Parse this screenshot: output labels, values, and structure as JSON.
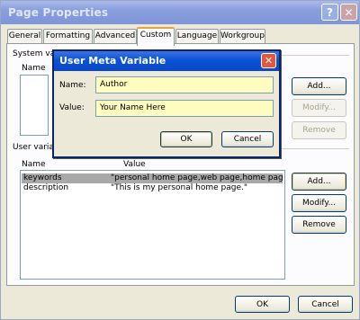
{
  "window": {
    "title": "Page Properties",
    "help_glyph": "?",
    "close_glyph": "✕"
  },
  "tabs": [
    "General",
    "Formatting",
    "Advanced",
    "Custom",
    "Language",
    "Workgroup"
  ],
  "active_tab": "Custom",
  "system_vars": {
    "group_label": "System var",
    "col_name": "Name",
    "buttons": {
      "add": "Add...",
      "modify": "Modify...",
      "remove": "Remove"
    }
  },
  "user_vars": {
    "group_label": "User variab",
    "col_name": "Name",
    "col_value": "Value",
    "rows": [
      {
        "name": "keywords",
        "value": "\"personal home page,web page,home page,hobbi"
      },
      {
        "name": "description",
        "value": "\"This is my personal home page.\""
      }
    ],
    "buttons": {
      "add": "Add...",
      "modify": "Modify...",
      "remove": "Remove"
    }
  },
  "footer": {
    "ok": "OK",
    "cancel": "Cancel"
  },
  "dialog": {
    "title": "User Meta Variable",
    "close_glyph": "✕",
    "name_label": "Name:",
    "name_value": "Author",
    "value_label": "Value:",
    "value_value": "Your Name Here",
    "ok": "OK",
    "cancel": "Cancel"
  }
}
